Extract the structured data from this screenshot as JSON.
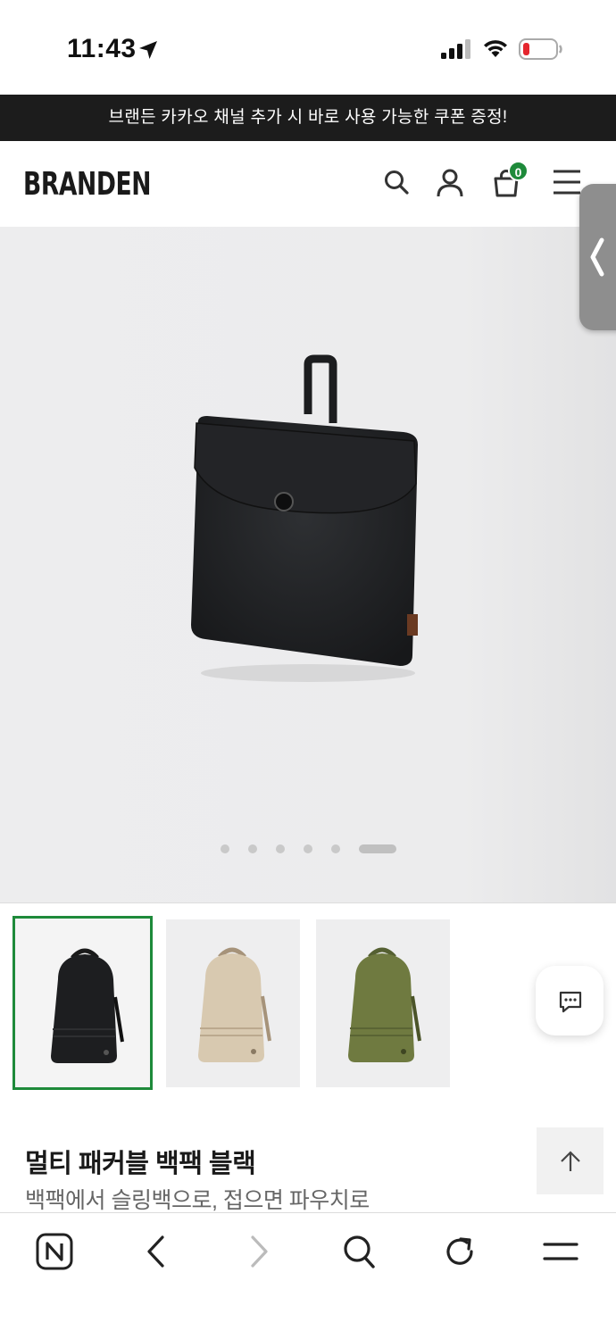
{
  "status_bar": {
    "time": "11:43"
  },
  "promo": {
    "text": "브랜든 카카오 채널 추가 시 바로 사용 가능한 쿠폰 증정!"
  },
  "header": {
    "logo": "BRANDEN",
    "cart_count": "0"
  },
  "gallery": {
    "slide_count": 6,
    "active_slide": 6
  },
  "thumbnails": [
    {
      "color": "black",
      "selected": true
    },
    {
      "color": "beige",
      "selected": false
    },
    {
      "color": "olive",
      "selected": false
    }
  ],
  "product": {
    "title": "멀티 패커블 백팩 블랙",
    "subtitle": "백팩에서 슬링백으로, 접으면 파우치로"
  },
  "colors": {
    "accent": "#1e8a3a",
    "banner": "#1c1c1c",
    "battery_low": "#e5262e"
  },
  "icons": [
    "location-arrow-icon",
    "signal-icon",
    "wifi-icon",
    "battery-icon",
    "search-icon",
    "user-icon",
    "cart-icon",
    "menu-icon",
    "chevron-left-icon",
    "chat-icon",
    "arrow-up-icon",
    "naver-icon",
    "back-icon",
    "forward-icon",
    "reload-icon"
  ]
}
